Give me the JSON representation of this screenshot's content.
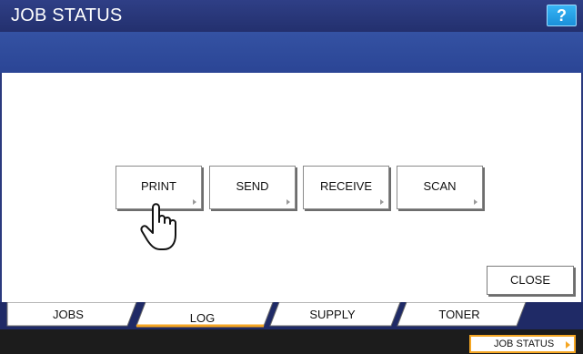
{
  "header": {
    "title": "JOB STATUS",
    "help_label": "?"
  },
  "log_buttons": [
    {
      "label": "PRINT"
    },
    {
      "label": "SEND"
    },
    {
      "label": "RECEIVE"
    },
    {
      "label": "SCAN"
    }
  ],
  "close_label": "CLOSE",
  "tabs": [
    {
      "label": "JOBS",
      "selected": false
    },
    {
      "label": "LOG",
      "selected": true
    },
    {
      "label": "SUPPLY",
      "selected": false
    },
    {
      "label": "TONER",
      "selected": false
    }
  ],
  "footer": {
    "job_status_label": "JOB STATUS"
  },
  "colors": {
    "title_bar": "#23306e",
    "sub_bar": "#2b4595",
    "help_button": "#1a8fd9",
    "tab_active_underline": "#f5a623",
    "job_status_border": "#f5a623"
  }
}
